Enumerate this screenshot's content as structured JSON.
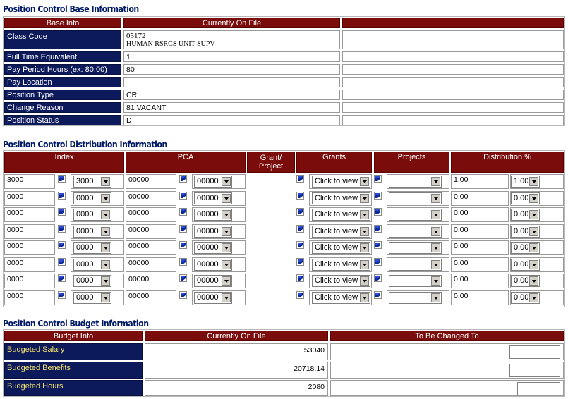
{
  "base": {
    "title": "Position Control Base Information",
    "headers": [
      "Base Info",
      "Currently On File",
      ""
    ],
    "rows": [
      {
        "label": "Class Code",
        "value": "05172",
        "value2": "HUMAN RSRCS UNIT SUPV"
      },
      {
        "label": "Full Time Equivalent",
        "value": "1"
      },
      {
        "label": "Pay Period Hours (ex: 80.00)",
        "value": "80"
      },
      {
        "label": "Pay Location",
        "value": ""
      },
      {
        "label": "Position Type",
        "value": "CR"
      },
      {
        "label": "Change Reason",
        "value": "81 VACANT"
      },
      {
        "label": "Position Status",
        "value": "D"
      }
    ]
  },
  "distribution": {
    "title": "Position Control Distribution Information",
    "headers": {
      "index": "Index",
      "pca": "PCA",
      "grant_project_1": "Grant/",
      "grant_project_2": "Project",
      "grants": "Grants",
      "projects": "Projects",
      "distribution": "Distribution %"
    },
    "rows": [
      {
        "index": "3000",
        "index_sel": "3000",
        "pca": "00000",
        "pca_sel": "00000",
        "grants_sel": "Click to view",
        "projects_sel": "",
        "dist": "1.00",
        "dist_sel": "1.00"
      },
      {
        "index": "0000",
        "index_sel": "0000",
        "pca": "00000",
        "pca_sel": "00000",
        "grants_sel": "Click to view",
        "projects_sel": "",
        "dist": "0.00",
        "dist_sel": "0.00"
      },
      {
        "index": "0000",
        "index_sel": "0000",
        "pca": "00000",
        "pca_sel": "00000",
        "grants_sel": "Click to view",
        "projects_sel": "",
        "dist": "0.00",
        "dist_sel": "0.00"
      },
      {
        "index": "0000",
        "index_sel": "0000",
        "pca": "00000",
        "pca_sel": "00000",
        "grants_sel": "Click to view",
        "projects_sel": "",
        "dist": "0.00",
        "dist_sel": "0.00"
      },
      {
        "index": "0000",
        "index_sel": "0000",
        "pca": "00000",
        "pca_sel": "00000",
        "grants_sel": "Click to view",
        "projects_sel": "",
        "dist": "0.00",
        "dist_sel": "0.00"
      },
      {
        "index": "0000",
        "index_sel": "0000",
        "pca": "00000",
        "pca_sel": "00000",
        "grants_sel": "Click to view",
        "projects_sel": "",
        "dist": "0.00",
        "dist_sel": "0.00"
      },
      {
        "index": "0000",
        "index_sel": "0000",
        "pca": "00000",
        "pca_sel": "00000",
        "grants_sel": "Click to view",
        "projects_sel": "",
        "dist": "0.00",
        "dist_sel": "0.00"
      },
      {
        "index": "0000",
        "index_sel": "0000",
        "pca": "00000",
        "pca_sel": "00000",
        "grants_sel": "Click to view",
        "projects_sel": "",
        "dist": "0.00",
        "dist_sel": "0.00"
      }
    ]
  },
  "budget": {
    "title": "Position Control Budget Information",
    "headers": [
      "Budget Info",
      "Currently On File",
      "To Be Changed To"
    ],
    "rows": [
      {
        "label": "Budgeted Salary",
        "value": "53040"
      },
      {
        "label": "Budgeted Benefits",
        "value": "20718.14"
      },
      {
        "label": "Budgeted Hours",
        "value": "2080"
      }
    ]
  },
  "colors": {
    "header_bg": "#7a0c0c",
    "label_bg": "#0c1a5c",
    "title_text": "#001a66",
    "budget_label_text": "#f2e06a"
  },
  "icons": {
    "checkbox": "checkbox-checked-icon",
    "dropdown": "chevron-down-icon"
  }
}
